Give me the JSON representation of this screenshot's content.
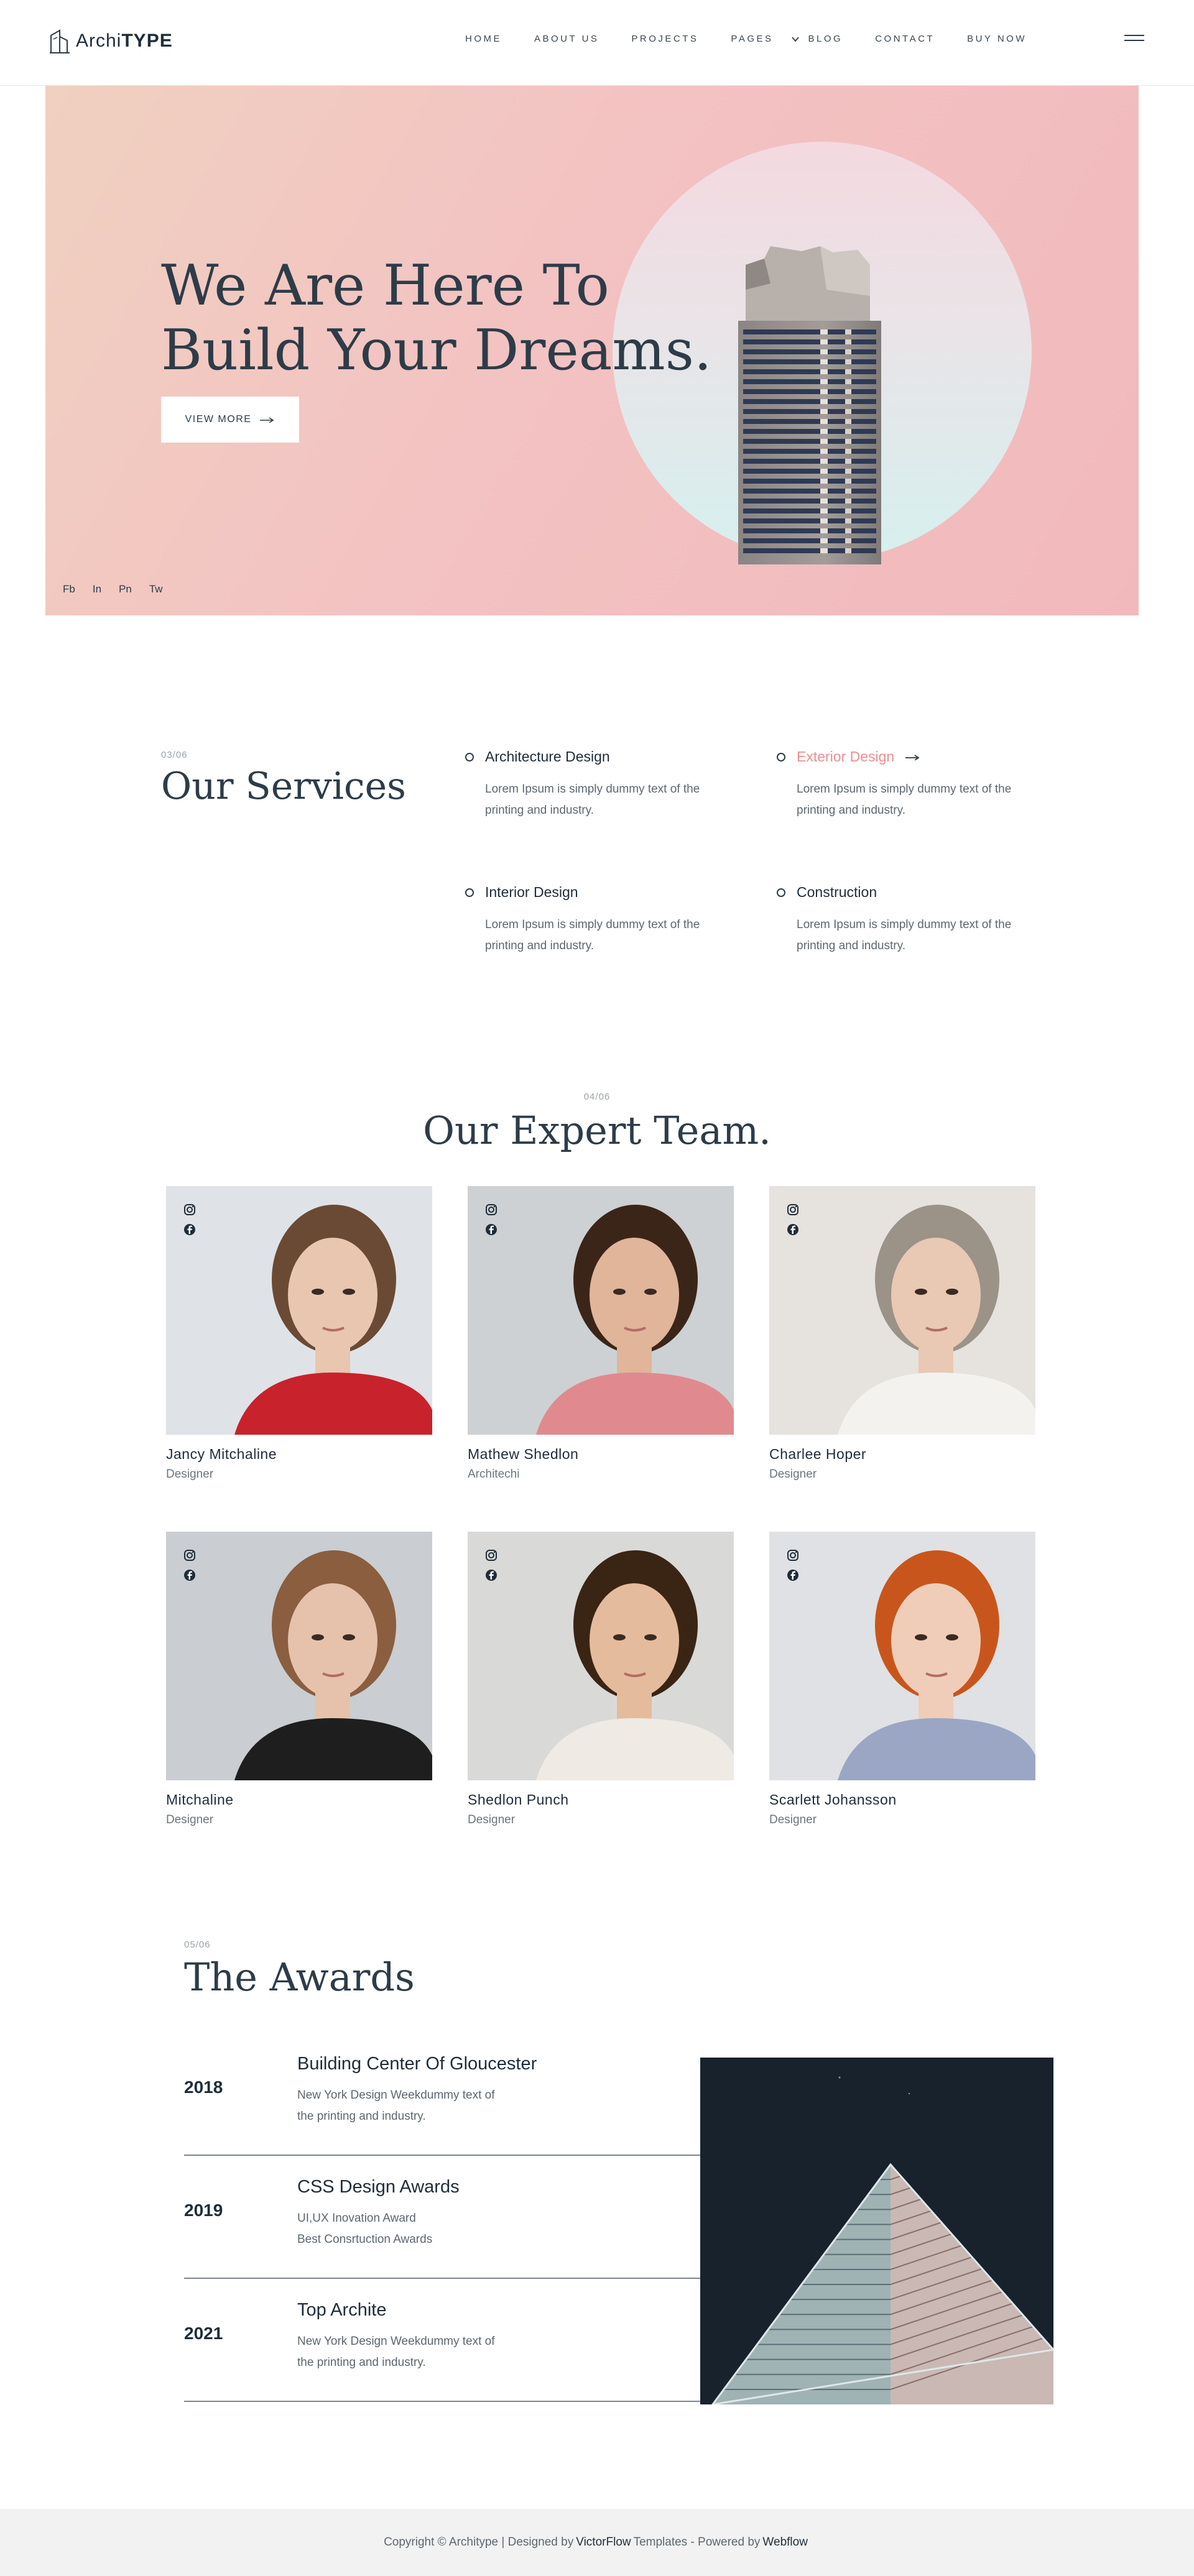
{
  "brand": {
    "name_light": "Archi",
    "name_bold": "TYPE"
  },
  "nav": [
    {
      "label": "HOME"
    },
    {
      "label": "ABOUT US"
    },
    {
      "label": "PROJECTS"
    },
    {
      "label": "PAGES"
    },
    {
      "label": "BLOG"
    },
    {
      "label": "CONTACT"
    },
    {
      "label": "BUY NOW"
    }
  ],
  "hero": {
    "title_line1": "We Are Here To",
    "title_line2": "Build Your Dreams.",
    "button_label": "VIEW MORE",
    "social": [
      "Fb",
      "In",
      "Pn",
      "Tw"
    ]
  },
  "services": {
    "number": "03/06",
    "title": "Our Services",
    "items": [
      {
        "title": "Architecture Design",
        "desc": "Lorem Ipsum is simply dummy text of the printing and industry."
      },
      {
        "title": "Exterior Design",
        "desc": "Lorem Ipsum is simply dummy text of the printing and industry."
      },
      {
        "title": "Interior Design",
        "desc": "Lorem Ipsum is simply dummy text of the printing and industry."
      },
      {
        "title": "Construction",
        "desc": "Lorem Ipsum is simply dummy text of the printing and industry."
      }
    ]
  },
  "team": {
    "number": "04/06",
    "title": "Our Expert Team.",
    "members": [
      {
        "name": "Jancy Mitchaline",
        "role": "Designer"
      },
      {
        "name": "Mathew Shedlon",
        "role": "Architechi"
      },
      {
        "name": "Charlee Hoper",
        "role": "Designer"
      },
      {
        "name": "Mitchaline",
        "role": "Designer"
      },
      {
        "name": "Shedlon Punch",
        "role": "Designer"
      },
      {
        "name": "Scarlett Johansson",
        "role": "Designer"
      }
    ]
  },
  "awards": {
    "number": "05/06",
    "title": "The Awards",
    "items": [
      {
        "year": "2018",
        "name": "Building Center Of Gloucester",
        "line1": "New York Design Weekdummy text of",
        "line2": "the printing and industry."
      },
      {
        "year": "2019",
        "name": "CSS Design Awards",
        "line1": "UI,UX Inovation Award",
        "line2": "Best Consrtuction Awards"
      },
      {
        "year": "2021",
        "name": "Top Archite",
        "line1": "New York Design Weekdummy text of",
        "line2": "the printing and industry."
      }
    ]
  },
  "footer": {
    "prefix": "Copyright © Architype | Designed by",
    "designer": "VictorFlow",
    "middle": "Templates - Powered by",
    "platform": "Webflow"
  },
  "colors": {
    "accent": "#ec8f92",
    "text_dark": "#1f2d3a",
    "hero_bg": "#f3c2c2",
    "footer_bg": "#f2f2f2"
  }
}
